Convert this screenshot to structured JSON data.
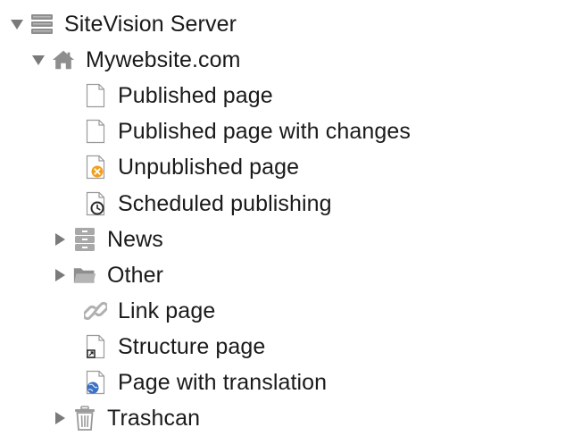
{
  "tree": {
    "root": {
      "label": "SiteVision Server",
      "expanded": true,
      "icon": "server-icon"
    },
    "site": {
      "label": "Mywebsite.com",
      "expanded": true,
      "icon": "home-icon"
    },
    "items": [
      {
        "label": "Published page",
        "icon": "page-icon"
      },
      {
        "label": "Published page with changes",
        "icon": "page-icon"
      },
      {
        "label": "Unpublished page",
        "icon": "unpublished-page-icon"
      },
      {
        "label": "Scheduled publishing",
        "icon": "scheduled-page-icon"
      },
      {
        "label": "News",
        "icon": "archive-icon",
        "expandable": true,
        "expanded": false
      },
      {
        "label": "Other",
        "icon": "folder-icon",
        "expandable": true,
        "expanded": false
      },
      {
        "label": "Link page",
        "icon": "link-icon"
      },
      {
        "label": "Structure page",
        "icon": "structure-page-icon"
      },
      {
        "label": "Page with translation",
        "icon": "translation-page-icon"
      },
      {
        "label": "Trashcan",
        "icon": "trash-icon",
        "expandable": true,
        "expanded": false
      }
    ]
  },
  "colors": {
    "icon_gray": "#9a9a9a",
    "twisty_gray": "#7a7a7a",
    "unpublished_badge": "#f0a020",
    "translation_globe": "#3a6fc4",
    "text": "#1a1a1a"
  }
}
